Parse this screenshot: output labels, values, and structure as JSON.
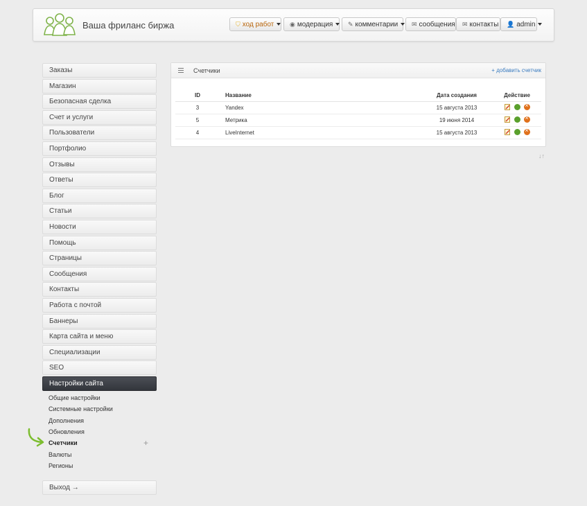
{
  "header": {
    "site_title": "Ваша фриланс биржа",
    "buttons": [
      {
        "label": "ход работ",
        "icon": "shield-icon",
        "caret": true
      },
      {
        "label": "модерация",
        "icon": "eye-icon",
        "caret": true
      },
      {
        "label": "комментарии",
        "icon": "pencil-icon",
        "caret": true
      },
      {
        "label": "сообщения",
        "icon": "envelope-icon",
        "caret": false
      },
      {
        "label": "контакты",
        "icon": "envelope-icon",
        "caret": false
      },
      {
        "label": "admin",
        "icon": "user-icon",
        "caret": true
      }
    ]
  },
  "sidebar": {
    "items": [
      "Заказы",
      "Магазин",
      "Безопасная сделка",
      "Счет и услуги",
      "Пользователи",
      "Портфолио",
      "Отзывы",
      "Ответы",
      "Блог",
      "Статьи",
      "Новости",
      "Помощь",
      "Страницы",
      "Сообщения",
      "Контакты",
      "Работа с почтой",
      "Баннеры",
      "Карта сайта и меню",
      "Специализации",
      "SEO"
    ],
    "active": "Настройки сайта",
    "subitems": [
      "Общие настройки",
      "Системные настройки",
      "Дополнения",
      "Обновления",
      "Счетчики",
      "Валюты",
      "Регионы"
    ],
    "current_subitem": "Счетчики",
    "logout": "Выход →"
  },
  "panel": {
    "title": "Счетчики",
    "add_link": "+ добавить счетчик",
    "columns": {
      "id": "ID",
      "name": "Название",
      "date": "Дата создания",
      "action": "Действие"
    },
    "rows": [
      {
        "id": "3",
        "name": "Yandex",
        "date": "15 августа 2013"
      },
      {
        "id": "5",
        "name": "Метрика",
        "date": "19 июня 2014"
      },
      {
        "id": "4",
        "name": "LiveInternet",
        "date": "15 августа 2013"
      }
    ]
  },
  "sort_icon": "↓↑",
  "colors": {
    "active_menu": "#3a3d43",
    "enable_icon": "#5aa02c",
    "delete_icon": "#e0711c",
    "link": "#3a7bbf",
    "arrow": "#7cbd2f"
  }
}
